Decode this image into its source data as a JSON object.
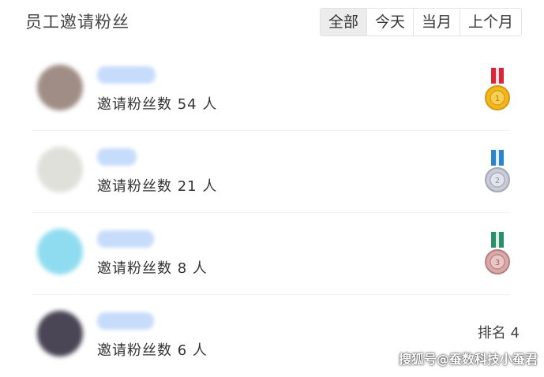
{
  "header": {
    "title": "员工邀请粉丝",
    "tabs": [
      {
        "label": "全部",
        "active": true
      },
      {
        "label": "今天",
        "active": false
      },
      {
        "label": "当月",
        "active": false
      },
      {
        "label": "上个月",
        "active": false
      }
    ]
  },
  "rows": [
    {
      "count_text": "邀请粉丝数 54 人",
      "avatar_color": "#a08e86",
      "medal": "gold",
      "rank_text": ""
    },
    {
      "count_text": "邀请粉丝数 21 人",
      "avatar_color": "#dfe0da",
      "medal": "silver",
      "rank_text": ""
    },
    {
      "count_text": "邀请粉丝数 8 人",
      "avatar_color": "#8fdcf0",
      "medal": "bronze",
      "rank_text": ""
    },
    {
      "count_text": "邀请粉丝数 6 人",
      "avatar_color": "#4a4656",
      "medal": "",
      "rank_text": "排名 4"
    }
  ],
  "colors": {
    "gold_ribbon": "#d8263a",
    "gold_disc": "#f3b61f",
    "silver_ribbon": "#2e84c9",
    "silver_disc": "#c9ccd6",
    "bronze_ribbon": "#2b8f6e",
    "bronze_disc": "#d9a8a8"
  },
  "watermark": "搜狐号@蚕数科技小蚕君"
}
